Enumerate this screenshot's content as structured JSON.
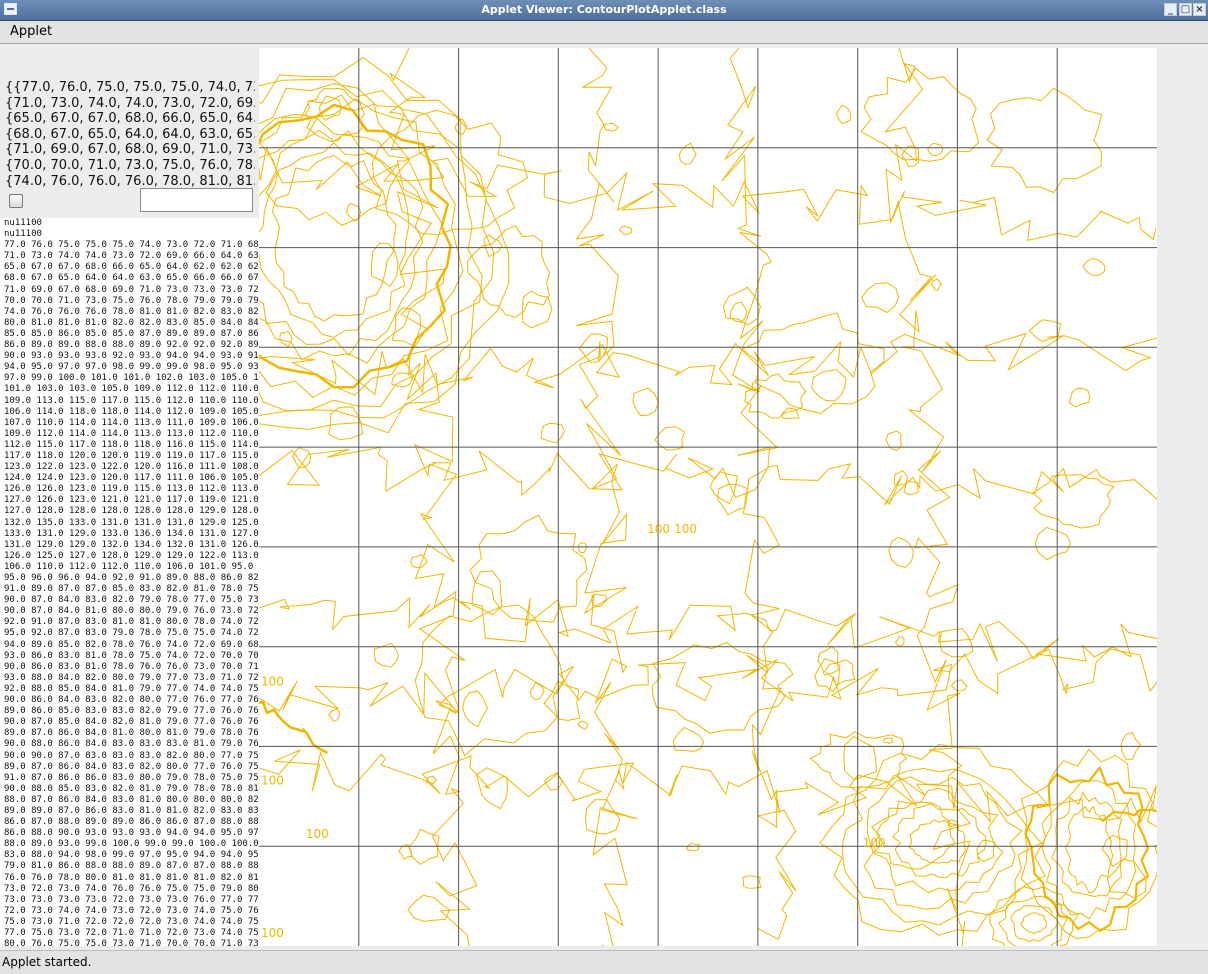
{
  "window": {
    "title": "Applet Viewer: ContourPlotApplet.class",
    "controls": [
      "_",
      "□",
      "×"
    ]
  },
  "menu": {
    "items": [
      "Applet"
    ]
  },
  "left_panel": {
    "array_lines": [
      "{{77.0, 76.0, 75.0, 75.0, 75.0, 74.0, 73.0",
      "{71.0, 73.0, 74.0, 74.0, 73.0, 72.0, 69.0,",
      "{65.0, 67.0, 67.0, 68.0, 66.0, 65.0, 64.0,",
      "{68.0, 67.0, 65.0, 64.0, 64.0, 63.0, 65.0,",
      "{71.0, 69.0, 67.0, 68.0, 69.0, 71.0, 73.0,",
      "{70.0, 70.0, 71.0, 73.0, 75.0, 76.0, 78.0,",
      "{74.0, 76.0, 76.0, 76.0, 78.0, 81.0, 81.0,"
    ],
    "checkbox_checked": false,
    "text_field_value": "",
    "output_lines": [
      "nu11100",
      "nu11100",
      "77.0 76.0 75.0 75.0 75.0 74.0 73.0 72.0 71.0 68.0",
      "71.0 73.0 74.0 74.0 73.0 72.0 69.0 66.0 64.0 63.0",
      "65.0 67.0 67.0 68.0 66.0 65.0 64.0 62.0 62.0 62.0",
      "68.0 67.0 65.0 64.0 64.0 63.0 65.0 66.0 66.0 67.0",
      "71.0 69.0 67.0 68.0 69.0 71.0 73.0 73.0 73.0 72.0",
      "70.0 70.0 71.0 73.0 75.0 76.0 78.0 79.0 79.0 79.0",
      "74.0 76.0 76.0 76.0 78.0 81.0 81.0 82.0 83.0 82.0",
      "80.0 81.0 81.0 81.0 82.0 82.0 83.0 85.0 84.0 84.0",
      "85.0 85.0 86.0 85.0 85.0 87.0 89.0 89.0 87.0 86.0",
      "86.0 89.0 89.0 88.0 88.0 89.0 92.0 92.0 92.0 89.0",
      "90.0 93.0 93.0 93.0 92.0 93.0 94.0 94.0 93.0 91.0",
      "94.0 95.0 97.0 97.0 98.0 99.0 99.0 98.0 95.0 93.0",
      "97.0 99.0 100.0 101.0 101.0 102.0 103.0 105.0 106.",
      "101.0 103.0 103.0 105.0 109.0 112.0 112.0 110.0 10",
      "109.0 113.0 115.0 117.0 115.0 112.0 110.0 110.0 10",
      "106.0 114.0 118.0 118.0 114.0 112.0 109.0 105.0 10",
      "107.0 110.0 114.0 114.0 113.0 111.0 109.0 106.0 10",
      "109.0 112.0 114.0 114.0 113.0 113.0 112.0 110.0 10",
      "112.0 115.0 117.0 118.0 118.0 116.0 115.0 114.0 11",
      "117.0 118.0 120.0 120.0 119.0 119.0 117.0 115.0 11",
      "123.0 122.0 123.0 122.0 120.0 116.0 111.0 108.0 10",
      "124.0 124.0 123.0 120.0 117.0 111.0 106.0 105.0 10",
      "126.0 126.0 123.0 119.0 115.0 113.0 112.0 113.0 11",
      "127.0 126.0 123.0 121.0 121.0 117.0 119.0 121.0 11",
      "127.0 128.0 128.0 128.0 128.0 128.0 129.0 128.0 12",
      "132.0 135.0 133.0 131.0 131.0 131.0 129.0 125.0 11",
      "133.0 131.0 129.0 133.0 136.0 134.0 131.0 127.0 12",
      "131.0 129.0 129.0 132.0 134.0 132.0 131.0 126.0 11",
      "126.0 125.0 127.0 128.0 129.0 129.0 122.0 113.0 10",
      "106.0 110.0 112.0 112.0 110.0 106.0 101.0 95.0 91.",
      "95.0 96.0 96.0 94.0 92.0 91.0 89.0 88.0 86.0 82.0",
      "91.0 89.0 87.0 87.0 85.0 83.0 82.0 81.0 78.0 75.0",
      "90.0 87.0 84.0 83.0 82.0 79.0 78.0 77.0 75.0 73.0",
      "90.0 87.0 84.0 81.0 80.0 80.0 79.0 76.0 73.0 72.0",
      "92.0 91.0 87.0 83.0 81.0 81.0 80.0 78.0 74.0 72.0",
      "95.0 92.0 87.0 83.0 79.0 78.0 75.0 75.0 74.0 72.0",
      "94.0 89.0 85.0 82.0 78.0 76.0 74.0 72.0 69.0 68.0",
      "93.0 86.0 83.0 81.0 78.0 75.0 74.0 72.0 70.0 70.0",
      "90.0 86.0 83.0 81.0 78.0 76.0 76.0 73.0 70.0 71.0",
      "93.0 88.0 84.0 82.0 80.0 79.0 77.0 73.0 71.0 72.0",
      "92.0 88.0 85.0 84.0 81.0 79.0 77.0 74.0 74.0 75.0",
      "90.0 86.0 84.0 83.0 82.0 80.0 77.0 76.0 77.0 76.0",
      "89.0 86.0 85.0 83.0 83.0 82.0 79.0 77.0 76.0 76.0",
      "90.0 87.0 85.0 84.0 82.0 81.0 79.0 77.0 76.0 76.0",
      "89.0 87.0 86.0 84.0 81.0 80.0 81.0 79.0 78.0 76.0",
      "90.0 88.0 86.0 84.0 83.0 83.0 83.0 81.0 79.0 76.0",
      "90.0 90.0 87.0 83.0 83.0 83.0 82.0 80.0 77.0 75.0",
      "89.0 87.0 86.0 84.0 83.0 82.0 80.0 77.0 76.0 75.0",
      "91.0 87.0 86.0 86.0 83.0 80.0 79.0 78.0 75.0 75.0",
      "90.0 88.0 85.0 83.0 82.0 81.0 79.0 78.0 78.0 81.0",
      "88.0 87.0 86.0 84.0 83.0 81.0 80.0 80.0 80.0 82.0",
      "89.0 89.0 87.0 86.0 83.0 81.0 81.0 82.0 83.0 83.0",
      "86.0 87.0 88.0 89.0 89.0 86.0 86.0 87.0 88.0 88.0",
      "86.0 88.0 90.0 93.0 93.0 93.0 94.0 94.0 95.0 97.0",
      "88.0 89.0 93.0 99.0 100.0 99.0 99.0 100.0 100.0 99",
      "83.0 88.0 94.0 98.0 99.0 97.0 95.0 94.0 94.0 95.0",
      "79.0 81.0 86.0 88.0 88.0 89.0 87.0 87.0 88.0 88.0",
      "76.0 76.0 78.0 80.0 81.0 81.0 81.0 81.0 82.0 81.0",
      "73.0 72.0 73.0 74.0 76.0 76.0 75.0 75.0 79.0 80.0",
      "73.0 73.0 73.0 73.0 72.0 73.0 73.0 76.0 77.0 77.0",
      "72.0 73.0 74.0 74.0 73.0 72.0 73.0 74.0 75.0 76.0",
      "75.0 73.0 71.0 72.0 72.0 72.0 73.0 74.0 74.0 75.0",
      "77.0 75.0 73.0 72.0 71.0 71.0 72.0 73.0 74.0 75.0",
      "80.0 76.0 75.0 75.0 73.0 71.0 70.0 70.0 71.0 73.0"
    ]
  },
  "contour_plot": {
    "line_color": "#f2b600",
    "grid_color": "#555555",
    "grid_divisions": 9,
    "labels": [
      {
        "text": "100",
        "at": [
          0.0,
          0.71
        ]
      },
      {
        "text": "100",
        "at": [
          0.43,
          0.54
        ]
      },
      {
        "text": "100",
        "at": [
          0.46,
          0.54
        ]
      },
      {
        "text": "100",
        "at": [
          0.0,
          0.82
        ]
      },
      {
        "text": "100",
        "at": [
          0.05,
          0.88
        ]
      },
      {
        "text": "100",
        "at": [
          0.67,
          0.89
        ]
      },
      {
        "text": "100",
        "at": [
          0.0,
          0.99
        ]
      }
    ]
  },
  "status": {
    "text": "Applet started."
  }
}
